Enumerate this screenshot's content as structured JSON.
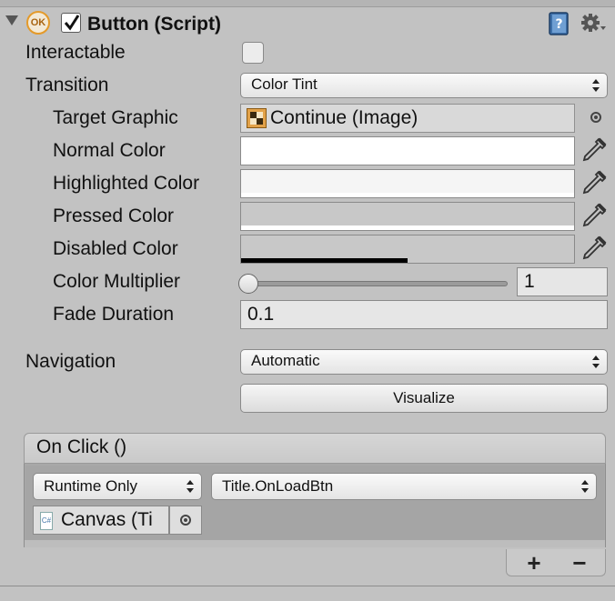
{
  "header": {
    "ok_icon_text": "OK",
    "title": "Button (Script)",
    "enabled": true,
    "icons": [
      "foldout-arrow-icon",
      "ok-icon",
      "book-help-icon",
      "gear-icon"
    ]
  },
  "rows": {
    "interactable_label": "Interactable",
    "interactable_checked": false,
    "transition_label": "Transition",
    "transition_value": "Color Tint",
    "target_graphic_label": "Target Graphic",
    "target_graphic_value": "Continue (Image)",
    "normal_color_label": "Normal Color",
    "highlighted_color_label": "Highlighted Color",
    "pressed_color_label": "Pressed Color",
    "disabled_color_label": "Disabled Color",
    "color_multiplier_label": "Color Multiplier",
    "color_multiplier_value": "1",
    "color_multiplier_fraction": 0,
    "fade_duration_label": "Fade Duration",
    "fade_duration_value": "0.1",
    "navigation_label": "Navigation",
    "navigation_value": "Automatic",
    "visualize_label": "Visualize"
  },
  "colors": {
    "normal": "#ffffff",
    "highlighted": "#f5f5f5",
    "pressed": "#c8c8c8",
    "disabled": "#c8c8c8",
    "disabled_alpha": 0.5
  },
  "on_click": {
    "title": "On Click ()",
    "runtime_value": "Runtime Only",
    "function_value": "Title.OnLoadBtn",
    "target_object": "Canvas (Ti",
    "add_label": "+",
    "remove_label": "−"
  }
}
